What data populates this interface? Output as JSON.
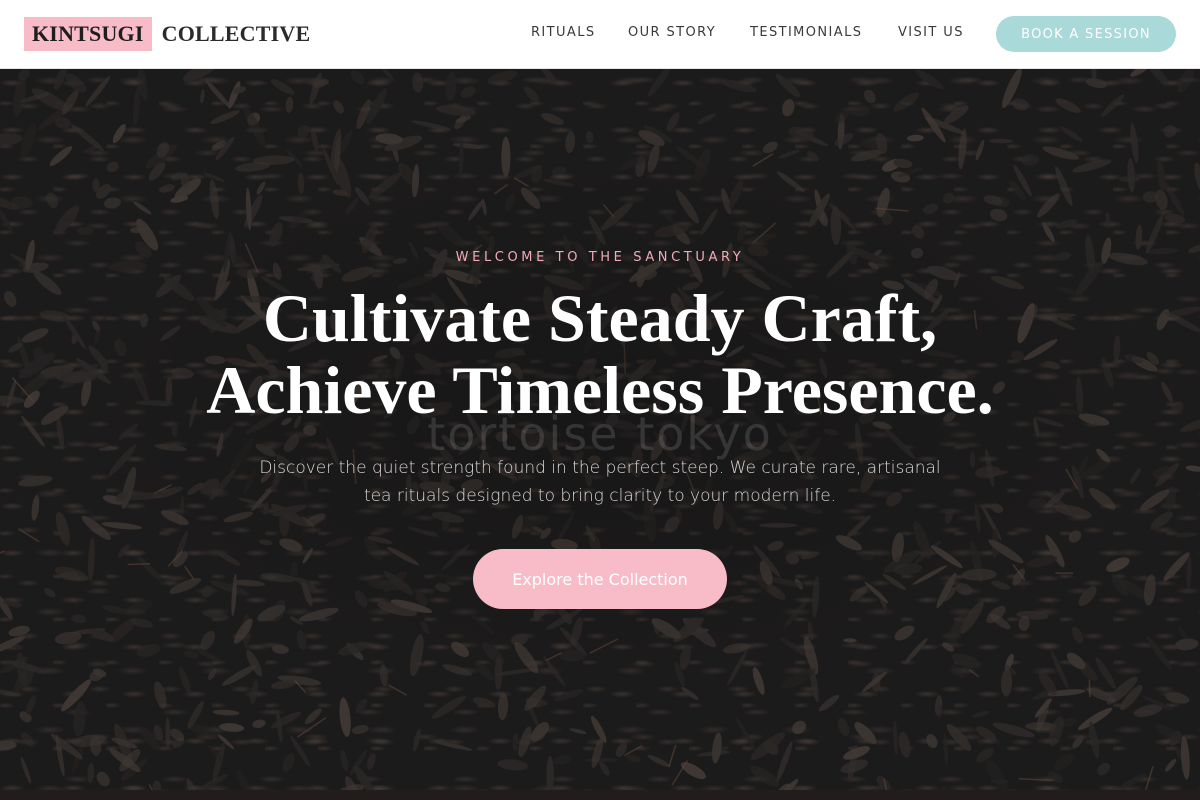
{
  "brand": {
    "highlight": "KINTSUGI",
    "rest": "COLLECTIVE"
  },
  "nav": {
    "items": [
      {
        "label": "RITUALS"
      },
      {
        "label": "OUR STORY"
      },
      {
        "label": "TESTIMONIALS"
      },
      {
        "label": "VISIT US"
      }
    ],
    "cta_label": "BOOK A SESSION"
  },
  "hero": {
    "eyebrow": "WELCOME TO THE SANCTUARY",
    "headline_line1": "Cultivate Steady Craft,",
    "headline_line2": "Achieve Timeless Presence.",
    "watermark": "tortoise tokyo",
    "subtext": "Discover the quiet strength found in the perfect steep. We curate rare, artisanal tea rituals designed to bring clarity to your modern life.",
    "cta_label": "Explore the Collection"
  },
  "colors": {
    "brand_pink": "#f8bcc8",
    "accent_teal": "#a9d9d8",
    "eyebrow_pink": "#f2a9b8",
    "hero_dark": "#1c1b1b"
  }
}
